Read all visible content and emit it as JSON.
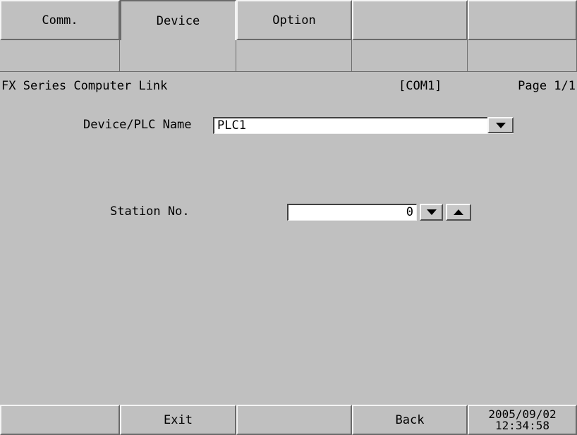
{
  "tabs": {
    "comm": "Comm.",
    "device": "Device",
    "option": "Option",
    "tab4": "",
    "tab5": ""
  },
  "info": {
    "driver": "FX Series Computer Link",
    "port": "[COM1]",
    "page": "Page 1/1"
  },
  "form": {
    "device_label": "Device/PLC Name",
    "device_value": "PLC1",
    "station_label": "Station No.",
    "station_value": "0"
  },
  "footer": {
    "exit": "Exit",
    "back": "Back",
    "date": "2005/09/02",
    "time": "12:34:58"
  }
}
